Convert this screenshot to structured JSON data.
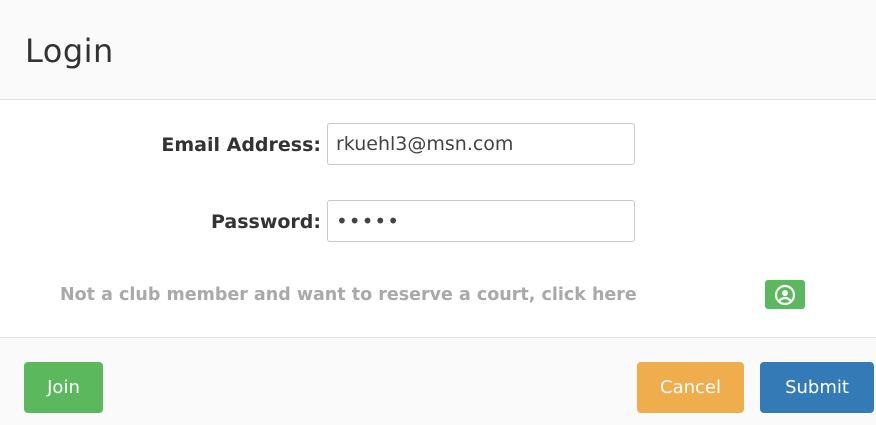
{
  "header": {
    "title": "Login"
  },
  "form": {
    "email": {
      "label": "Email Address:",
      "value": "rkuehl3@msn.com"
    },
    "password": {
      "label": "Password:",
      "value": "•••••"
    }
  },
  "member": {
    "text": "Not a club member and want to reserve a court, click here",
    "icon": "user-circle-icon"
  },
  "footer": {
    "join_label": "Join",
    "cancel_label": "Cancel",
    "submit_label": "Submit"
  },
  "colors": {
    "join": "#5cb85c",
    "cancel": "#f0ad4e",
    "submit": "#337ab7",
    "member_icon_bg": "#5cb85c"
  }
}
